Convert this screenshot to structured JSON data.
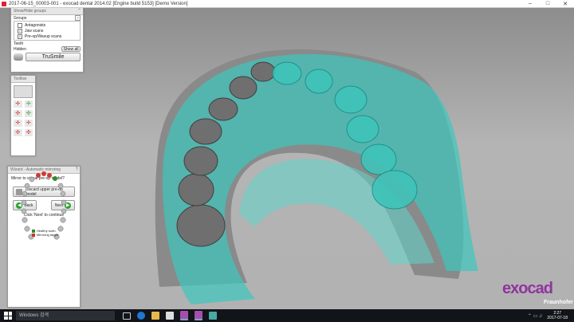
{
  "window": {
    "title": "2017-06-15_00003-001 - exocad dental 2014.02 [Engine build 5153] [Demo Version]",
    "minimize": "–",
    "maximize": "□",
    "close": "✕"
  },
  "show_hide_panel": {
    "title": "Show/Hide groups",
    "help": "?",
    "groups_label": "Groups",
    "items": [
      {
        "label": "Antagonists",
        "checked": false
      },
      {
        "label": "Jaw scans",
        "checked": true
      },
      {
        "label": "Pre-op/Waxup scans",
        "checked": true
      }
    ],
    "teeth_label": "Teeth",
    "hidden_label": "Hidden",
    "show_all_label": "Show all",
    "trusmile_label": "TruSmile"
  },
  "toolbar_panel": {
    "title": "Toolbar"
  },
  "wizard": {
    "title": "Wizard - Automatic mirroring",
    "help": "?",
    "question": "Mirror to virtual pre-op model?",
    "legend": [
      {
        "label": "Healthy tooth",
        "color": "#2f8a2f"
      },
      {
        "label": "Mirroring target",
        "color": "#c0392b"
      }
    ],
    "discard_label": "Discard upper pre-op model",
    "back_label": "Back",
    "next_label": "Next",
    "hint": "Click 'Next' to continue"
  },
  "logo": {
    "name": "exocad",
    "partner": "Fraunhofer"
  },
  "taskbar": {
    "search_placeholder": "Windows 검색",
    "time": "2:27",
    "date": "2017-07-18"
  }
}
